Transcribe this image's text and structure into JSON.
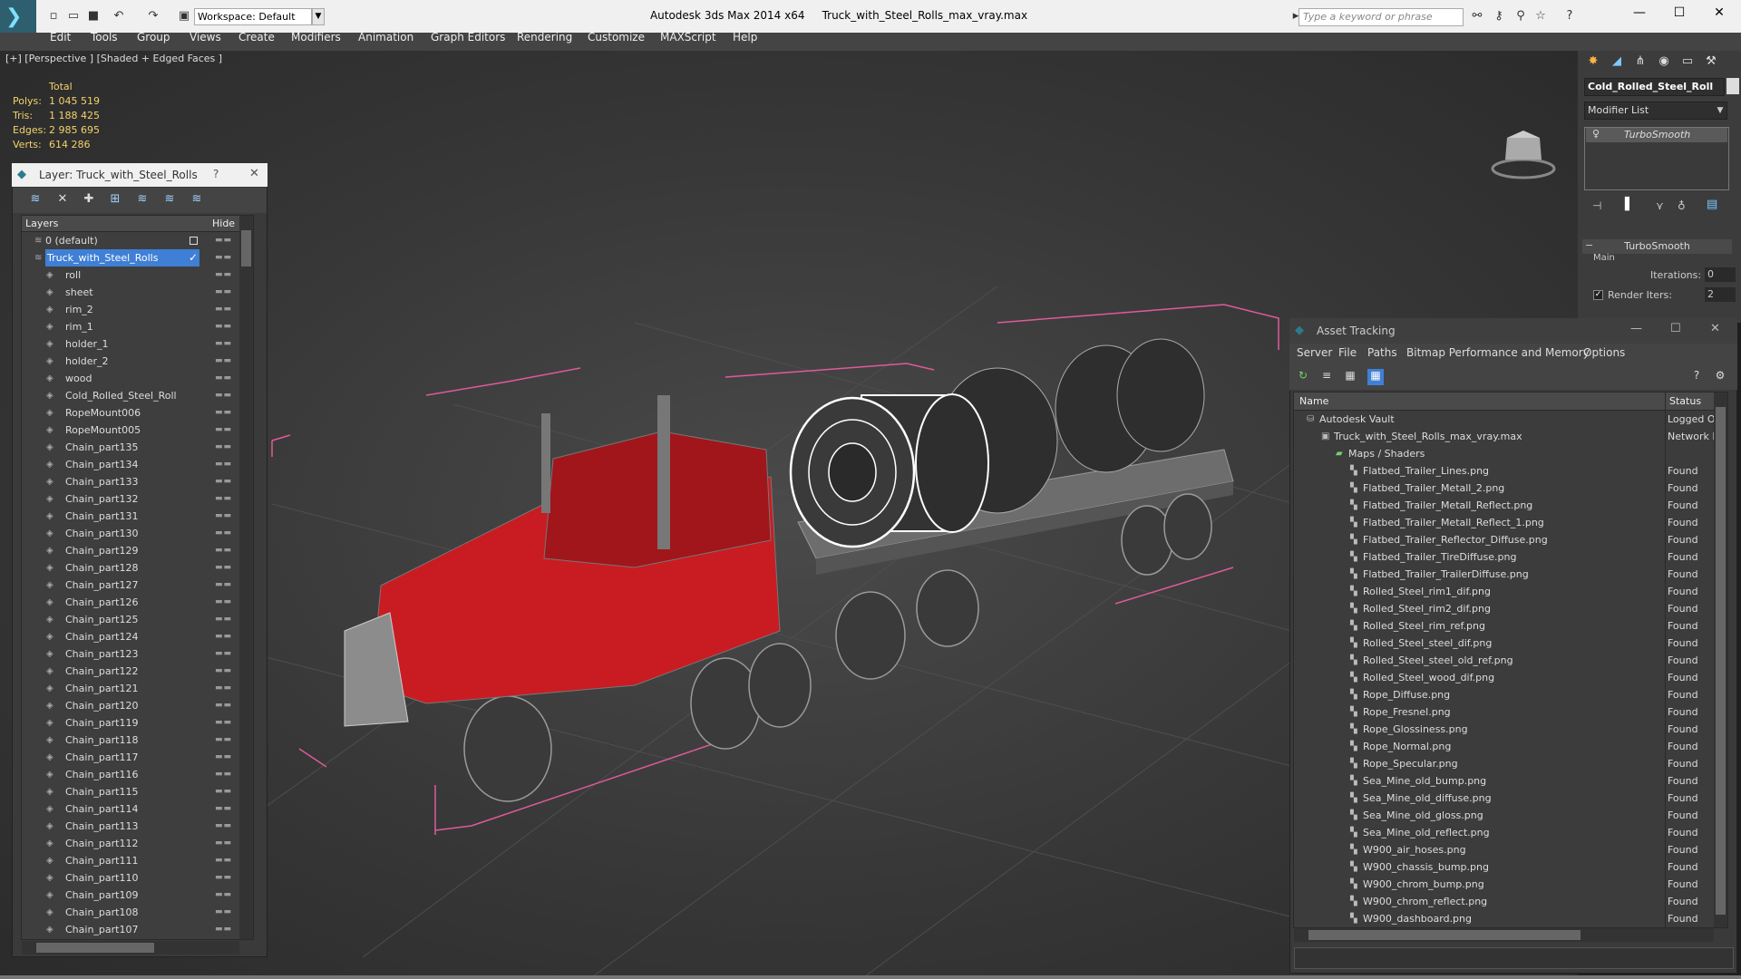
{
  "window": {
    "app_title": "Autodesk 3ds Max  2014 x64",
    "file_title": "Truck_with_Steel_Rolls_max_vray.max",
    "workspace": "Workspace: Default",
    "search_placeholder": "Type a keyword or phrase"
  },
  "menu": [
    "Edit",
    "Tools",
    "Group",
    "Views",
    "Create",
    "Modifiers",
    "Animation",
    "Graph Editors",
    "Rendering",
    "Customize",
    "MAXScript",
    "Help"
  ],
  "viewport": {
    "label": "[+] [Perspective ] [Shaded + Edged Faces ]",
    "stats": {
      "header": "Total",
      "rows": [
        {
          "label": "Polys:",
          "value": "1 045 519"
        },
        {
          "label": "Tris:",
          "value": "1 188 425"
        },
        {
          "label": "Edges:",
          "value": "2 985 695"
        },
        {
          "label": "Verts:",
          "value": "614 286"
        }
      ]
    }
  },
  "layer_panel": {
    "title": "Layer: Truck_with_Steel_Rolls",
    "help": "?",
    "close": "✕",
    "col_layers": "Layers",
    "col_hide": "Hide",
    "layers": [
      {
        "name": "0 (default)"
      },
      {
        "name": "Truck_with_Steel_Rolls"
      },
      {
        "name": "roll"
      },
      {
        "name": "sheet"
      },
      {
        "name": "rim_2"
      },
      {
        "name": "rim_1"
      },
      {
        "name": "holder_1"
      },
      {
        "name": "holder_2"
      },
      {
        "name": "wood"
      },
      {
        "name": "Cold_Rolled_Steel_Roll"
      },
      {
        "name": "RopeMount006"
      },
      {
        "name": "RopeMount005"
      },
      {
        "name": "Chain_part135"
      },
      {
        "name": "Chain_part134"
      },
      {
        "name": "Chain_part133"
      },
      {
        "name": "Chain_part132"
      },
      {
        "name": "Chain_part131"
      },
      {
        "name": "Chain_part130"
      },
      {
        "name": "Chain_part129"
      },
      {
        "name": "Chain_part128"
      },
      {
        "name": "Chain_part127"
      },
      {
        "name": "Chain_part126"
      },
      {
        "name": "Chain_part125"
      },
      {
        "name": "Chain_part124"
      },
      {
        "name": "Chain_part123"
      },
      {
        "name": "Chain_part122"
      },
      {
        "name": "Chain_part121"
      },
      {
        "name": "Chain_part120"
      },
      {
        "name": "Chain_part119"
      },
      {
        "name": "Chain_part118"
      },
      {
        "name": "Chain_part117"
      },
      {
        "name": "Chain_part116"
      },
      {
        "name": "Chain_part115"
      },
      {
        "name": "Chain_part114"
      },
      {
        "name": "Chain_part113"
      },
      {
        "name": "Chain_part112"
      },
      {
        "name": "Chain_part111"
      },
      {
        "name": "Chain_part110"
      },
      {
        "name": "Chain_part109"
      },
      {
        "name": "Chain_part108"
      },
      {
        "name": "Chain_part107"
      }
    ]
  },
  "command_panel": {
    "object_name": "Cold_Rolled_Steel_Roll",
    "modifier_list": "Modifier List",
    "stack_item": "TurboSmooth",
    "rollout": "TurboSmooth",
    "group": "Main",
    "iterations_label": "Iterations:",
    "iterations_value": "0",
    "render_iters_label": "Render Iters:",
    "render_iters_value": "2"
  },
  "asset_tracking": {
    "title": "Asset Tracking",
    "menu": [
      "Server",
      "File",
      "Paths",
      "Bitmap Performance and Memory",
      "Options"
    ],
    "col_name": "Name",
    "col_status": "Status",
    "rows": [
      {
        "name": "Autodesk Vault",
        "status": "Logged O"
      },
      {
        "name": "Truck_with_Steel_Rolls_max_vray.max",
        "status": "Network P"
      },
      {
        "name": "Maps / Shaders",
        "status": ""
      },
      {
        "name": "Flatbed_Trailer_Lines.png",
        "status": "Found"
      },
      {
        "name": "Flatbed_Trailer_Metall_2.png",
        "status": "Found"
      },
      {
        "name": "Flatbed_Trailer_Metall_Reflect.png",
        "status": "Found"
      },
      {
        "name": "Flatbed_Trailer_Metall_Reflect_1.png",
        "status": "Found"
      },
      {
        "name": "Flatbed_Trailer_Reflector_Diffuse.png",
        "status": "Found"
      },
      {
        "name": "Flatbed_Trailer_TireDiffuse.png",
        "status": "Found"
      },
      {
        "name": "Flatbed_Trailer_TrailerDiffuse.png",
        "status": "Found"
      },
      {
        "name": "Rolled_Steel_rim1_dif.png",
        "status": "Found"
      },
      {
        "name": "Rolled_Steel_rim2_dif.png",
        "status": "Found"
      },
      {
        "name": "Rolled_Steel_rim_ref.png",
        "status": "Found"
      },
      {
        "name": "Rolled_Steel_steel_dif.png",
        "status": "Found"
      },
      {
        "name": "Rolled_Steel_steel_old_ref.png",
        "status": "Found"
      },
      {
        "name": "Rolled_Steel_wood_dif.png",
        "status": "Found"
      },
      {
        "name": "Rope_Diffuse.png",
        "status": "Found"
      },
      {
        "name": "Rope_Fresnel.png",
        "status": "Found"
      },
      {
        "name": "Rope_Glossiness.png",
        "status": "Found"
      },
      {
        "name": "Rope_Normal.png",
        "status": "Found"
      },
      {
        "name": "Rope_Specular.png",
        "status": "Found"
      },
      {
        "name": "Sea_Mine_old_bump.png",
        "status": "Found"
      },
      {
        "name": "Sea_Mine_old_diffuse.png",
        "status": "Found"
      },
      {
        "name": "Sea_Mine_old_gloss.png",
        "status": "Found"
      },
      {
        "name": "Sea_Mine_old_reflect.png",
        "status": "Found"
      },
      {
        "name": "W900_air_hoses.png",
        "status": "Found"
      },
      {
        "name": "W900_chassis_bump.png",
        "status": "Found"
      },
      {
        "name": "W900_chrom_bump.png",
        "status": "Found"
      },
      {
        "name": "W900_chrom_reflect.png",
        "status": "Found"
      },
      {
        "name": "W900_dashboard.png",
        "status": "Found"
      }
    ]
  },
  "colors": {
    "selection": "#3f7fd6",
    "stats": "#f3d26b",
    "truck_red": "#c81c22",
    "bbox_pink": "#e05a9a"
  }
}
